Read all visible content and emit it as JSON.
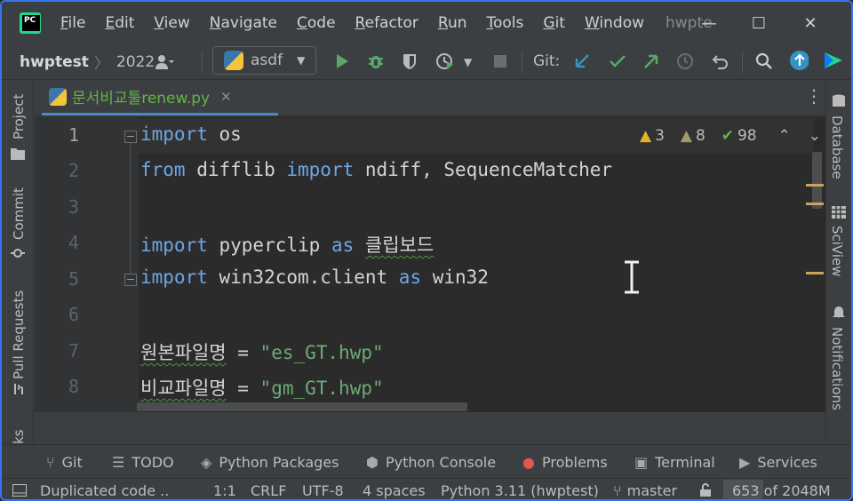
{
  "titlebar": {
    "menu": [
      "File",
      "Edit",
      "View",
      "Navigate",
      "Code",
      "Refactor",
      "Run",
      "Tools",
      "Git",
      "Window"
    ],
    "project_title": "hwpte",
    "minimize": "—",
    "maximize": "☐",
    "close": "✕"
  },
  "toolbar": {
    "breadcrumb_project": "hwptest",
    "breadcrumb_folder": "2022",
    "run_config": "asdf",
    "git_label": "Git:"
  },
  "left_stripe": {
    "project": "Project",
    "commit": "Commit",
    "pull_requests": "Pull Requests",
    "bookmarks_partial": "ks"
  },
  "right_stripe": {
    "database": "Database",
    "sciview": "SciView",
    "notifications": "Notifications"
  },
  "tab": {
    "filename": "문서비교툴renew.py",
    "close": "✕"
  },
  "inspections": {
    "errors": "3",
    "warnings": "8",
    "typos": "98"
  },
  "editor": {
    "line_numbers": [
      "1",
      "2",
      "3",
      "4",
      "5",
      "6",
      "7",
      "8"
    ],
    "current_line": 1,
    "lines": {
      "l1_kw": "import",
      "l1_rest": " os",
      "l2_kw1": "from",
      "l2_mid": " difflib ",
      "l2_kw2": "import",
      "l2_rest": " ndiff, SequenceMatcher",
      "l4_kw": "import",
      "l4_mid": " pyperclip ",
      "l4_kw2": "as",
      "l4_name": "클립보드",
      "l5_kw": "import",
      "l5_mid": " win32com.client ",
      "l5_kw2": "as",
      "l5_rest": " win32",
      "l7_name": "원본파일명",
      "l7_eq": " = ",
      "l7_str": "\"es_GT.hwp\"",
      "l8_name": "비교파일명",
      "l8_eq": " = ",
      "l8_str": "\"gm_GT.hwp\""
    }
  },
  "tool_windows": {
    "git": "Git",
    "todo": "TODO",
    "python_packages": "Python Packages",
    "python_console": "Python Console",
    "problems": "Problems",
    "terminal": "Terminal",
    "services": "Services"
  },
  "status": {
    "message": "Duplicated code ..",
    "position": "1:1",
    "line_sep": "CRLF",
    "encoding": "UTF-8",
    "indent": "4 spaces",
    "interpreter": "Python 3.11 (hwptest)",
    "branch": "master",
    "memory": "653 of 2048M",
    "memory_used_fraction": 0.32
  },
  "colors": {
    "keyword": "#6ca7e6",
    "string": "#6aab73",
    "accent": "#3574f0",
    "tab_name": "#62b543"
  }
}
